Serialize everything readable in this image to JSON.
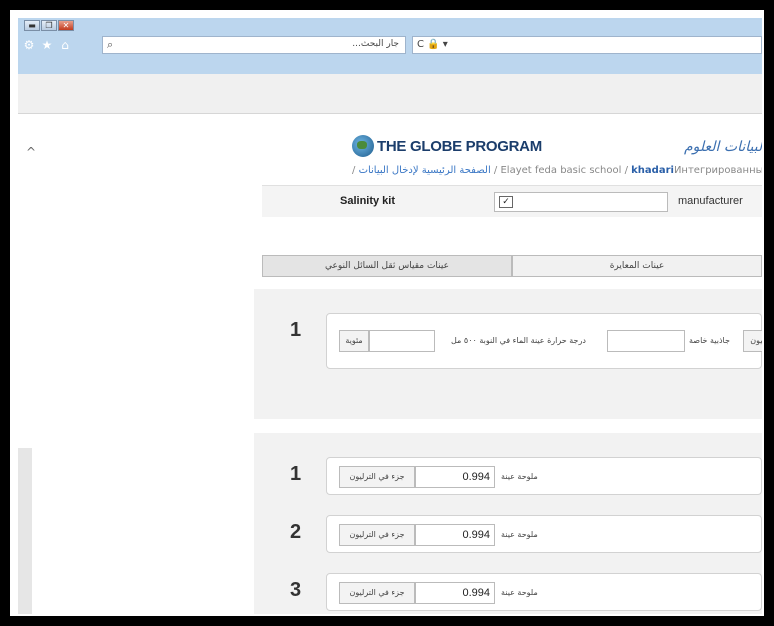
{
  "browser": {
    "search_placeholder": "...جار البحث",
    "search_glyph": "⌕",
    "address_tools": "C 🔒 ▾",
    "window_buttons": [
      "▬",
      "❐",
      "✕"
    ],
    "nav_icons": [
      "⚙",
      "★",
      "⌂"
    ]
  },
  "site": {
    "logo_text": "THE GLOBE PROGRAM",
    "arabic_title": "البيانات العلوم",
    "breadcrumb": {
      "user": "khadari",
      "user_suffix": "Интегрированный п",
      "sep1": " / ",
      "school": "Elayet feda basic school",
      "sep2": " / ",
      "home_link": "الصفحة الرئيسية لإدخال البيانات",
      "sep3": " / "
    }
  },
  "kit": {
    "label": "Salinity kit",
    "select_arrow": "✓",
    "manufacturer_label": "manufacturer"
  },
  "tabs": [
    {
      "label": "عينات المعايرة"
    },
    {
      "label": "عينات مقياس ثقل السائل النوعي"
    }
  ],
  "calibration": {
    "row_number": "1",
    "unit1": "ترليون",
    "gravity_label": "جاذبية خاصة",
    "temp_label": "درجة حرارة عينة الماء في النوبة ٥٠٠ مل",
    "unit2": "مئوية"
  },
  "samples": [
    {
      "number": "1",
      "label": "ملوحة عينة",
      "value": "0.994",
      "unit": "جزء في الترليون"
    },
    {
      "number": "2",
      "label": "ملوحة عينة",
      "value": "0.994",
      "unit": "جزء في الترليون"
    },
    {
      "number": "3",
      "label": "ملوحة عينة",
      "value": "0.994",
      "unit": "جزء في الترليون"
    }
  ]
}
